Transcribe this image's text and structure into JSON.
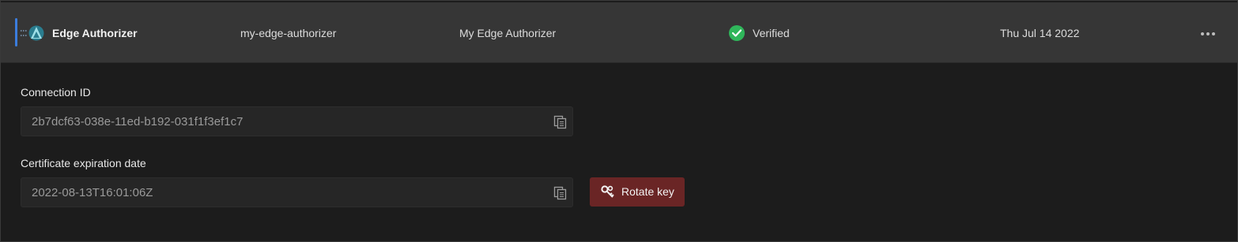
{
  "row": {
    "name": "Edge Authorizer",
    "slug": "my-edge-authorizer",
    "description": "My Edge Authorizer",
    "status": "Verified",
    "date": "Thu Jul 14 2022",
    "logo_icon": "edge-authorizer-logo-icon",
    "status_icon": "check-circle-icon",
    "menu_icon": "more-horizontal-icon"
  },
  "details": {
    "connection_id_label": "Connection ID",
    "connection_id_value": "2b7dcf63-038e-11ed-b192-031f1f3ef1c7",
    "cert_label": "Certificate expiration date",
    "cert_value": "2022-08-13T16:01:06Z",
    "copy_icon": "copy-icon",
    "rotate_button_label": "Rotate key",
    "rotate_icon": "key-icon"
  },
  "colors": {
    "accent": "#3b7ddd",
    "verified": "#2fb65a",
    "rotate_button": "#6a2525"
  }
}
